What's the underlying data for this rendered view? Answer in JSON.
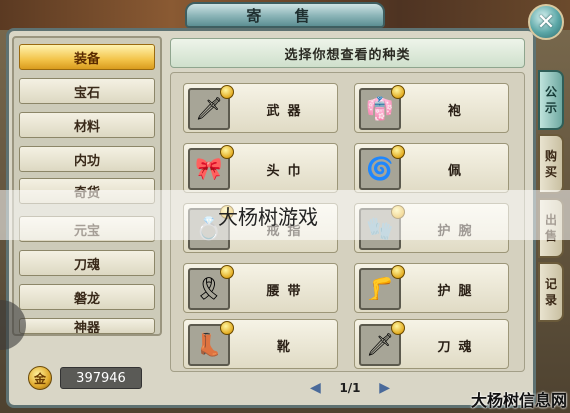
{
  "window": {
    "title": "寄 售",
    "close_label": "✕"
  },
  "categories": [
    {
      "label": "装备",
      "active": true
    },
    {
      "label": "宝石"
    },
    {
      "label": "材料"
    },
    {
      "label": "内功"
    },
    {
      "label": "奇货"
    },
    {
      "label": "元宝"
    },
    {
      "label": "刀魂"
    },
    {
      "label": "磐龙"
    },
    {
      "label": "神器"
    }
  ],
  "gold": {
    "icon": "gold-coin-icon",
    "glyph": "金",
    "value": "397946"
  },
  "main": {
    "header": "选择你想查看的种类",
    "items": [
      {
        "label": "武器",
        "icon": "weapon-icon",
        "glyph": "🗡"
      },
      {
        "label": "袍",
        "icon": "robe-icon",
        "glyph": "👘"
      },
      {
        "label": "头巾",
        "icon": "headband-icon",
        "glyph": "🎀"
      },
      {
        "label": "佩",
        "icon": "pendant-icon",
        "glyph": "🌀"
      },
      {
        "label": "戒指",
        "icon": "ring-icon",
        "glyph": "💍"
      },
      {
        "label": "护腕",
        "icon": "bracer-icon",
        "glyph": "🧤"
      },
      {
        "label": "腰带",
        "icon": "belt-icon",
        "glyph": "🎗"
      },
      {
        "label": "护腿",
        "icon": "leg-guard-icon",
        "glyph": "🦵"
      },
      {
        "label": "靴",
        "icon": "boots-icon",
        "glyph": "👢"
      },
      {
        "label": "刀魂",
        "icon": "blade-soul-icon",
        "glyph": "🗡"
      }
    ],
    "pager": {
      "prev": "◀",
      "text": "1/1",
      "next": "▶"
    }
  },
  "side_tabs": [
    {
      "label": "公示",
      "chars": [
        "公",
        "示"
      ],
      "active": true
    },
    {
      "label": "购买",
      "chars": [
        "购",
        "买"
      ]
    },
    {
      "label": "出售",
      "chars": [
        "出",
        "售"
      ]
    },
    {
      "label": "记录",
      "chars": [
        "记",
        "录"
      ]
    }
  ],
  "watermark": {
    "center": "大杨树游戏",
    "corner": "大杨树信息网"
  }
}
